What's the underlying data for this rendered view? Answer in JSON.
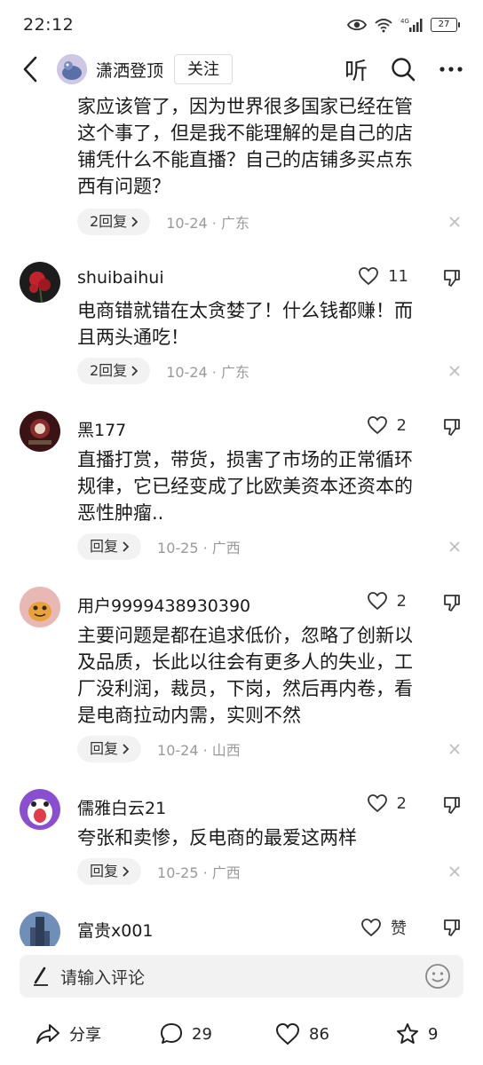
{
  "status_bar": {
    "time": "22:12",
    "network": "4G",
    "battery": "27"
  },
  "header": {
    "author_name": "潇洒登顶",
    "follow_label": "关注",
    "listen_label": "听"
  },
  "comments": [
    {
      "name": "",
      "text_lines": [
        "家应该管了，因为世界很多国家已经在管",
        "这个事了，但是我不能理解的是自己的店",
        "铺凭什么不能直播？自己的店铺多买点东",
        "西有问题？"
      ],
      "reply_label": "2回复",
      "meta": "10-24 · 广东"
    },
    {
      "name": "shuibaihui",
      "likes": "11",
      "text_lines": [
        "电商错就错在太贪婪了！什么钱都赚！而",
        "且两头通吃！"
      ],
      "reply_label": "2回复",
      "meta": "10-24 · 广东"
    },
    {
      "name": "黑177",
      "likes": "2",
      "text_lines": [
        "直播打赏，带货，损害了市场的正常循环",
        "规律，它已经变成了比欧美资本还资本的",
        "恶性肿瘤.."
      ],
      "reply_label": "回复",
      "meta": "10-25 · 广西"
    },
    {
      "name": "用户9999438930390",
      "likes": "2",
      "text_lines": [
        "主要问题是都在追求低价，忽略了创新以",
        "及品质，长此以往会有更多人的失业，工",
        "厂没利润，裁员，下岗，然后再内卷，看",
        "是电商拉动内需，实则不然"
      ],
      "reply_label": "回复",
      "meta": "10-24 · 山西"
    },
    {
      "name": "儒雅白云21",
      "likes": "2",
      "text_lines": [
        "夸张和卖惨，反电商的最爱这两样"
      ],
      "reply_label": "回复",
      "meta": "10-25 · 广西"
    },
    {
      "name": "富贵x001",
      "likes": "赞",
      "text_lines": [],
      "reply_label": "",
      "meta": ""
    }
  ],
  "input": {
    "placeholder": "请输入评论"
  },
  "bottom_bar": {
    "share_label": "分享",
    "comment_count": "29",
    "like_count": "86",
    "favorite_count": "9"
  },
  "colors": {
    "accent": "#1a1a1a",
    "muted": "#9a9a9a",
    "pill_bg": "#f2f2f2"
  }
}
